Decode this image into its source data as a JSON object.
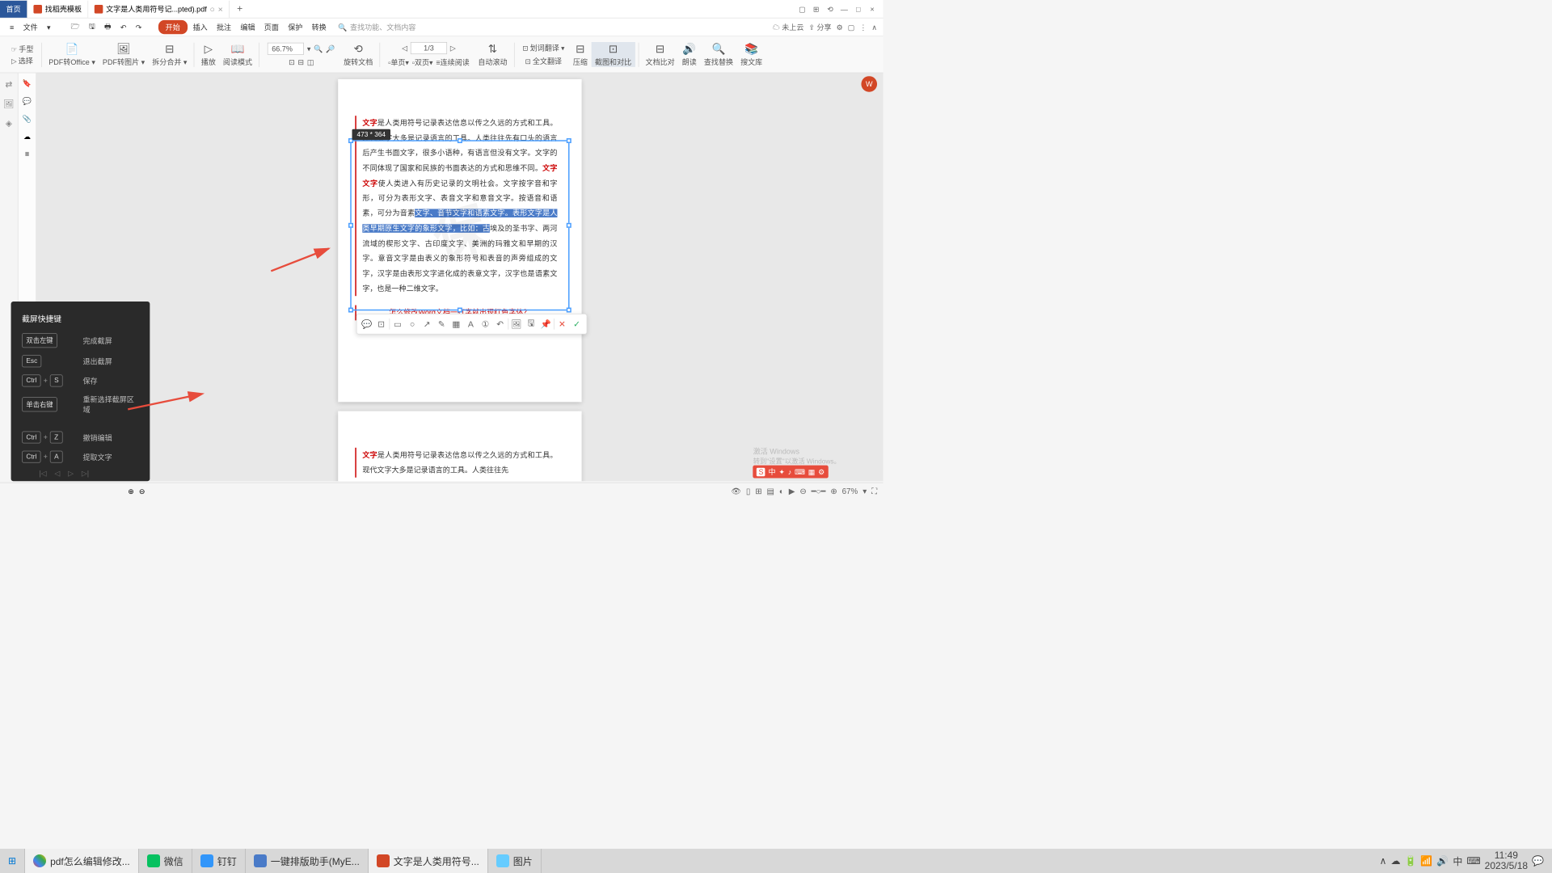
{
  "tabs": {
    "home": "首页",
    "template": "找稻壳模板",
    "doc": "文字是人类用符号记...pted).pdf"
  },
  "menu": {
    "file": "文件",
    "start": "开始",
    "insert": "插入",
    "review": "批注",
    "edit": "编辑",
    "page": "页面",
    "protect": "保护",
    "convert": "转换",
    "search_ph": "查找功能、文档内容"
  },
  "cloud": {
    "notsync": "未上云",
    "share": "分享"
  },
  "tools": {
    "hand": "手型",
    "select": "选择",
    "pdf2office": "PDF转Office",
    "pdf2img": "PDF转图片",
    "split": "拆分合并",
    "play": "播放",
    "readmode": "阅读模式",
    "zoom": "66.7%",
    "page": "1/3",
    "rotate": "旋转文档",
    "single": "单页",
    "double": "双页",
    "continuous": "连续阅读",
    "autoscroll": "自动滚动",
    "linetrans": "划词翻译",
    "fulltrans": "全文翻译",
    "compress": "压缩",
    "screenshot": "截图和对比",
    "compare": "文档比对",
    "read": "朗读",
    "findreplace": "查找替换",
    "search": "搜文库"
  },
  "selection": {
    "size": "473 * 364"
  },
  "document": {
    "p1_red": "文字",
    "p1_a": "是人类用符号记录表达信息以传之久远的方式和工具。现代文字大多是记录语言的工具。人类往往先有口头的语言后产生书面文字，很多小语种，有语言但没有文字。文字的不同体现了国家和民族的书面表达的方式和思维不同。",
    "p1_red2": "文字文字",
    "p1_b": "使人类进入有历史记录的文明社会。文字按字音和字形，可分为表形文字、表音文字和意音文字。按语音和语素，可分为音素",
    "p1_hl": "文字、音节文字和语素文字。表形文字是人类早期原生文字的象形文字，比如：古",
    "p1_c": "埃及的圣书字、两河流域的楔形文字、古印度文字、美洲的玛雅文和早期的汉字。意音文字是由表义的象形符号和表音的声旁组成的文字，汉字是由表形文字进化成的表意文字，汉字也是语素文字，也是一种二维文字。",
    "p1_link": "怎么修改Word文档一打字就出现红色字体？",
    "p2_red": "文字",
    "p2_a": "是人类用符号记录表达信息以传之久远的方式和工具。现代文字大多是记录语言的工具。人类往往先"
  },
  "shortcuts": {
    "title": "截屏快捷键",
    "rows": [
      {
        "keys": [
          "双击左键"
        ],
        "label": "完成截屏"
      },
      {
        "keys": [
          "Esc"
        ],
        "label": "退出截屏"
      },
      {
        "keys": [
          "Ctrl",
          "S"
        ],
        "label": "保存"
      },
      {
        "keys": [
          "单击右键"
        ],
        "label": "重新选择截屏区域"
      }
    ],
    "rows2": [
      {
        "keys": [
          "Ctrl",
          "Z"
        ],
        "label": "撤销编辑"
      },
      {
        "keys": [
          "Ctrl",
          "A"
        ],
        "label": "提取文字"
      }
    ]
  },
  "status": {
    "zoom": "67%"
  },
  "taskbar": {
    "items": [
      "pdf怎么编辑修改...",
      "微信",
      "钉钉",
      "一键排版助手(MyE...",
      "文字是人类用符号...",
      "图片"
    ],
    "time": "11:49",
    "date": "2023/5/18"
  },
  "activate": {
    "title": "激活 Windows",
    "sub": "转到\"设置\"以激活 Windows。"
  },
  "tray": {
    "ime": "中"
  },
  "watermark": "保"
}
